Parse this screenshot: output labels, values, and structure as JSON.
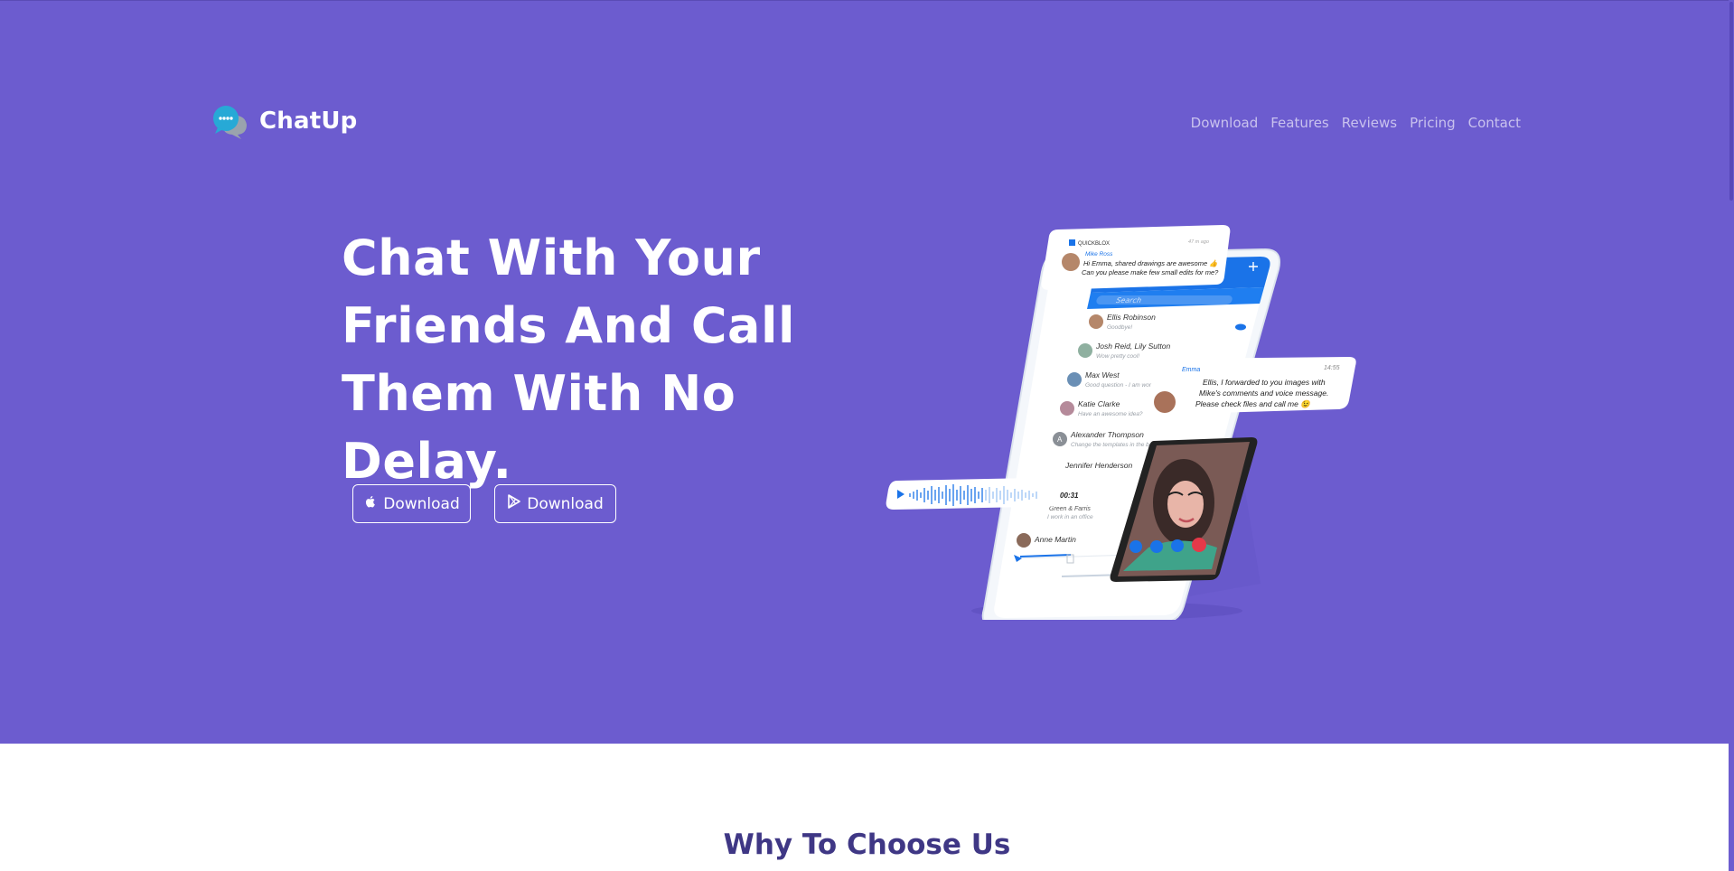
{
  "brand": {
    "name": "ChatUp",
    "logo_icon": "chat-bubbles-icon"
  },
  "nav": {
    "items": [
      "Download",
      "Features",
      "Reviews",
      "Pricing",
      "Contact"
    ]
  },
  "hero": {
    "headline_line1": "Chat With Your",
    "headline_line2": "Friends And Call",
    "headline_line3": "Them With No Delay.",
    "buttons": [
      {
        "label": "Download",
        "icon": "apple-icon"
      },
      {
        "label": "Download",
        "icon": "play-store-icon"
      }
    ]
  },
  "phone": {
    "notification": {
      "app": "QUICKBLOX",
      "time": "47 m ago",
      "sender": "Mike Ross",
      "message_line1": "Hi Emma, shared drawings are awesome 👍",
      "message_line2": "Can you please make few small edits for me?"
    },
    "search_placeholder": "Search",
    "chats": [
      {
        "name": "Ellis Robinson",
        "preview": "Goodbye!"
      },
      {
        "name": "Josh Reid, Lily Sutton",
        "preview": "Wow pretty cool!"
      },
      {
        "name": "Max West",
        "preview": "Good question - I am working"
      },
      {
        "name": "Katie Clarke",
        "preview": "Have an awesome idea?"
      },
      {
        "name": "Alexander Thompson",
        "preview": "Change the templates in the ba"
      },
      {
        "name": "Jennifer Henderson",
        "preview": ""
      },
      {
        "name": "Green & Farris",
        "preview": "I work in an office"
      },
      {
        "name": "Anne Martin",
        "preview": ""
      }
    ],
    "message_card": {
      "sender": "Emma",
      "time": "14:55",
      "line1": "Ellis, I forwarded to you images with",
      "line2": "Mike's comments and voice message.",
      "line3": "Please check files and call me 😉"
    },
    "voice": {
      "duration": "00:31"
    }
  },
  "section": {
    "title": "Why To Choose Us"
  },
  "colors": {
    "hero_bg": "#6c5ccf",
    "title": "#3f3785",
    "accent": "#1a73e8"
  }
}
